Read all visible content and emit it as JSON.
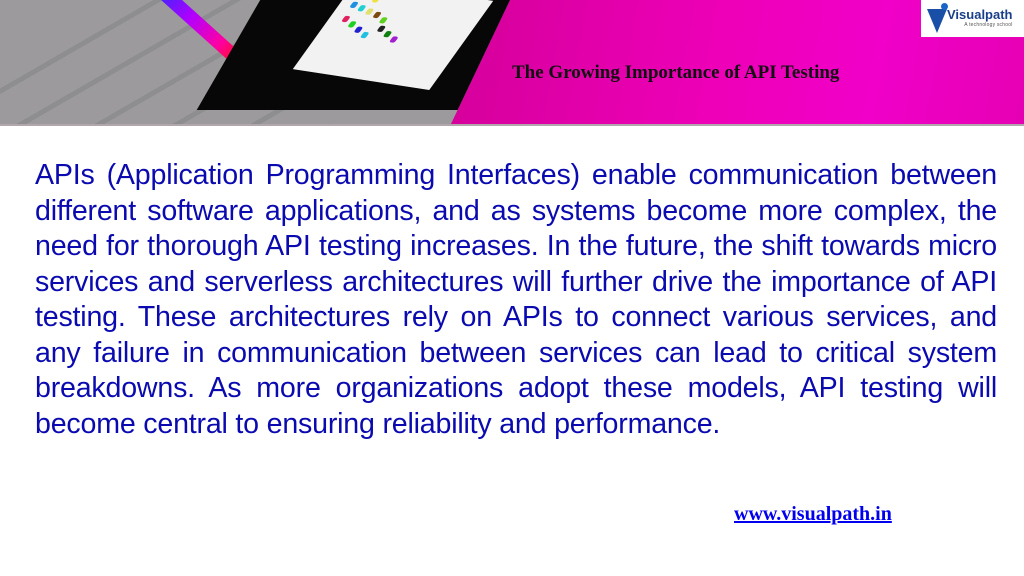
{
  "header": {
    "title": "The Growing Importance of API Testing",
    "colors": {
      "band_left": "#c8008f",
      "band_right": "#f000c8",
      "title": "#111111"
    }
  },
  "logo": {
    "name": "Visualpath",
    "tagline": "A technology school",
    "color": "#1a4fa8"
  },
  "body": {
    "paragraph": "APIs (Application Programming Interfaces) enable communication between different software applications, and as systems become more complex, the need for thorough API testing increases. In the future, the shift towards micro services and serverless architectures will further drive the importance of API testing. These architectures rely on APIs to connect various services, and any failure in communication between services can lead to critical system breakdowns. As more organizations adopt these models, API testing will become central to ensuring reliability and performance.",
    "color": "#0a0ab0"
  },
  "footer": {
    "link_text": "www.visualpath.in",
    "link_color": "#0000ee"
  },
  "images": {
    "header_photo": "laptop-keyboard-with-touch-bar-photo"
  }
}
